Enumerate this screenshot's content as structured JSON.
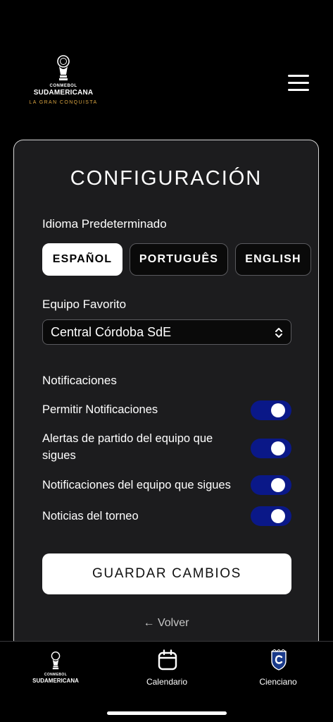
{
  "header": {
    "logo": {
      "top": "CONMEBOL",
      "name": "SUDAMERICANA",
      "tagline": "LA GRAN CONQUISTA"
    },
    "menu_icon": "hamburger-icon"
  },
  "settings": {
    "title": "CONFIGURACIÓN",
    "language": {
      "label": "Idioma Predeterminado",
      "options": [
        "ESPAÑOL",
        "PORTUGUÊS",
        "ENGLISH"
      ],
      "selected": "ESPAÑOL"
    },
    "team": {
      "label": "Equipo Favorito",
      "selected": "Central Córdoba SdE"
    },
    "notifications": {
      "label": "Notificaciones",
      "items": [
        {
          "label": "Permitir Notificaciones",
          "enabled": true
        },
        {
          "label": "Alertas de partido del equipo que sigues",
          "enabled": true
        },
        {
          "label": "Notificaciones del equipo que sigues",
          "enabled": true
        },
        {
          "label": "Noticias del torneo",
          "enabled": true
        }
      ]
    },
    "save_label": "GUARDAR CAMBIOS",
    "back_label": "← Volver"
  },
  "tabbar": {
    "home": {
      "logo_top": "CONMEBOL",
      "logo_name": "SUDAMERICANA"
    },
    "calendar": {
      "label": "Calendario",
      "icon": "calendar-icon"
    },
    "team": {
      "label": "Cienciano",
      "icon": "team-crest-icon"
    }
  },
  "colors": {
    "background": "#000000",
    "card": "#1c1c1e",
    "toggle_on": "#0a1888",
    "tagline_gold": "#d9a441"
  }
}
